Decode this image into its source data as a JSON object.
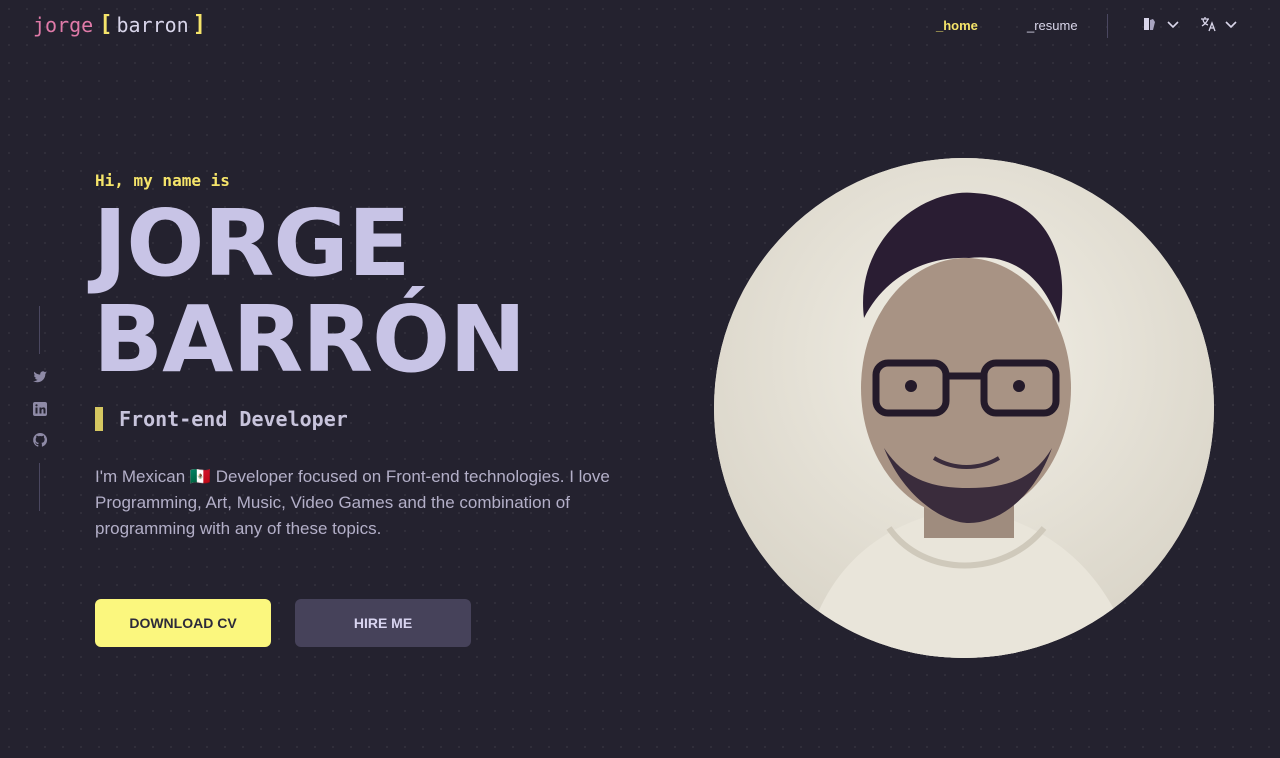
{
  "logo": {
    "first": "jorge",
    "open": "[",
    "last": "barron",
    "close": "]"
  },
  "nav": {
    "home": "_home",
    "resume": "_resume"
  },
  "theme_icon": "theme-icon",
  "language_icon": "translate-icon",
  "social": [
    "twitter-icon",
    "linkedin-icon",
    "github-icon"
  ],
  "hero": {
    "greeting": "Hi, my name is",
    "name_line1": "JORGE",
    "name_line2": "BARRÓN",
    "role": "Front-end Developer",
    "description": "I'm Mexican 🇲🇽 Developer focused on Front-end technologies. I love Programming, Art, Music, Video Games and the combination of programming with any of these topics."
  },
  "buttons": {
    "download": "DOWNLOAD CV",
    "hire": "HIRE ME"
  },
  "colors": {
    "accent": "#f5e46a",
    "background": "#24222f",
    "name": "#c8c4e6",
    "secondary_button": "#46425a"
  }
}
